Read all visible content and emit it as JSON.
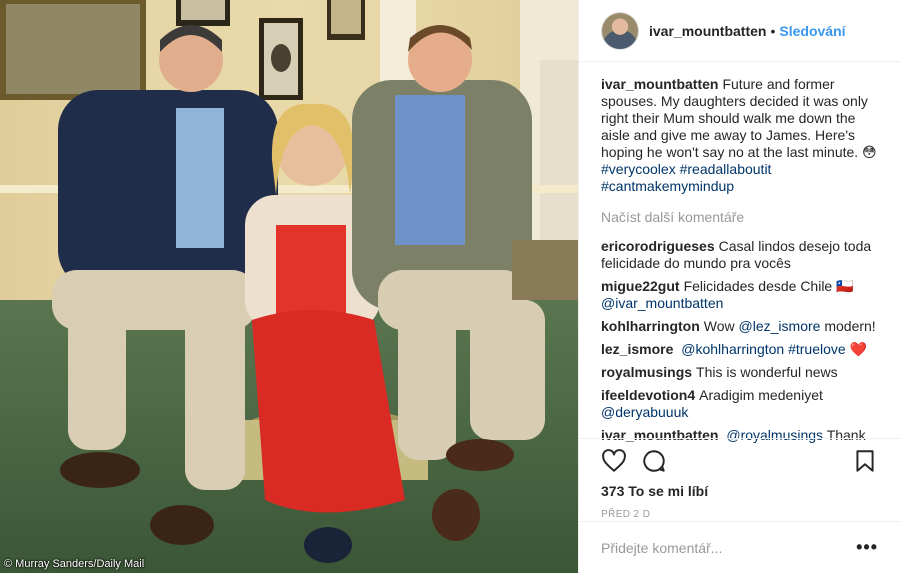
{
  "photo": {
    "alt": "",
    "credit": "© Murray Sanders/Daily Mail"
  },
  "header": {
    "username": "ivar_mountbatten",
    "separator": "•",
    "follow_label": "Sledování"
  },
  "caption": {
    "username": "ivar_mountbatten",
    "text": "Future and former spouses. My daughters decided it was only right their Mum should walk me down the aisle and give me away to James. Here's hoping he won't say no at the last minute. 😳",
    "hashtags": [
      "#verycoolex",
      "#readallaboutit",
      "#cantmakemymindup"
    ]
  },
  "load_more_label": "Načíst další komentáře",
  "comments": [
    {
      "username": "ericorodrigueses",
      "text": "Casal lindos desejo toda felicidade do mundo pra vocês",
      "mention": ""
    },
    {
      "username": "migue22gut",
      "text": "Felicidades desde Chile 🇨🇱",
      "mention": "@ivar_mountbatten"
    },
    {
      "username": "kohlharrington",
      "text": "Wow",
      "mention": "@lez_ismore",
      "after": "modern!"
    },
    {
      "username": "lez_ismore",
      "text": "",
      "mention": "@kohlharrington",
      "after": "#truelove ❤️"
    },
    {
      "username": "royalmusings",
      "text": "This is wonderful news",
      "mention": ""
    },
    {
      "username": "ifeeldevotion4",
      "text": "Aradigim medeniyet",
      "mention": "@deryabuuuk"
    },
    {
      "username": "ivar_mountbatten",
      "text": "",
      "mention": "@royalmusings",
      "after": "Thank you"
    }
  ],
  "likes": "373 To se mi líbí",
  "date": "PŘED 2 D",
  "add_comment": {
    "placeholder": "Přidejte komentář..."
  },
  "options_label": "•••",
  "icons": {
    "like": "heart-icon",
    "comment": "comment-icon",
    "save": "bookmark-icon"
  }
}
